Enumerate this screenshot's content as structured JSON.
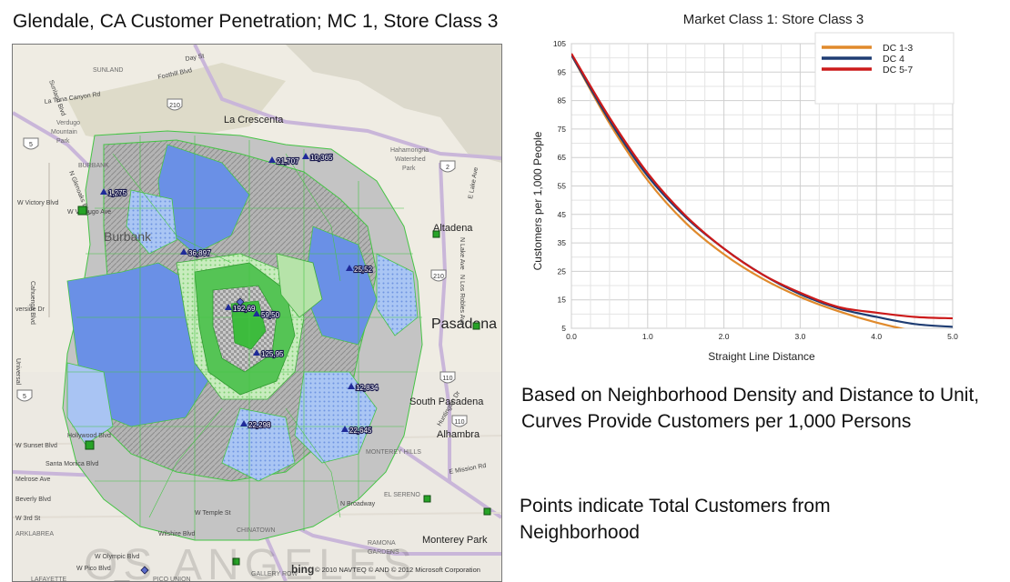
{
  "page": {
    "title": "Glendale, CA  Customer Penetration; MC 1, Store Class 3",
    "caption_curves": "Based on Neighborhood Density and Distance to Unit, Curves Provide Customers per 1,000 Persons",
    "caption_points": "Points indicate Total Customers from Neighborhood"
  },
  "map": {
    "place_labels": [
      {
        "text": "SUNLAND",
        "cls": "small"
      },
      {
        "text": "La Tuna Canyon Rd",
        "cls": "road"
      },
      {
        "text": "Verdugo",
        "cls": "small"
      },
      {
        "text": "Mountain",
        "cls": "small"
      },
      {
        "text": "Park",
        "cls": "small"
      },
      {
        "text": "La Crescenta",
        "cls": "town"
      },
      {
        "text": "Hahamongna",
        "cls": "small"
      },
      {
        "text": "Watershed",
        "cls": "small"
      },
      {
        "text": "Park",
        "cls": "small"
      },
      {
        "text": "Burbank",
        "cls": "townbig"
      },
      {
        "text": "Altadena",
        "cls": "town"
      },
      {
        "text": "Pasadena",
        "cls": "city"
      },
      {
        "text": "South Pasadena",
        "cls": "town"
      },
      {
        "text": "Alhambra",
        "cls": "town"
      },
      {
        "text": "MONTEREY HILLS",
        "cls": "small"
      },
      {
        "text": "EL SERENO",
        "cls": "small"
      },
      {
        "text": "Monterey Park",
        "cls": "town"
      },
      {
        "text": "CHINATOWN",
        "cls": "small"
      },
      {
        "text": "RAMONA",
        "cls": "small"
      },
      {
        "text": "GARDENS",
        "cls": "small"
      },
      {
        "text": "GALLERY ROW",
        "cls": "small"
      },
      {
        "text": "PICO UNION",
        "cls": "small"
      },
      {
        "text": "ARKLABREA",
        "cls": "small"
      },
      {
        "text": "Hollywood Blvd",
        "cls": "road"
      },
      {
        "text": "W Sunset Blvd",
        "cls": "road"
      },
      {
        "text": "Santa Monica Blvd",
        "cls": "road"
      },
      {
        "text": "Melrose Ave",
        "cls": "road"
      },
      {
        "text": "Beverly Blvd",
        "cls": "road"
      },
      {
        "text": "W 3rd St",
        "cls": "road"
      },
      {
        "text": "Wilshire Blvd",
        "cls": "road"
      },
      {
        "text": "W Olympic Blvd",
        "cls": "road"
      },
      {
        "text": "W Pico Blvd",
        "cls": "road"
      },
      {
        "text": "LAFAYETTE",
        "cls": "small"
      },
      {
        "text": "Universal",
        "cls": "road"
      },
      {
        "text": "verside Dr",
        "cls": "road"
      },
      {
        "text": "W Victory Blvd",
        "cls": "road"
      },
      {
        "text": "N Glenoaks Blvd",
        "cls": "road"
      },
      {
        "text": "W Verdugo Ave",
        "cls": "road"
      },
      {
        "text": "Foothill Blvd",
        "cls": "road"
      },
      {
        "text": "Day St",
        "cls": "road"
      },
      {
        "text": "Huntington Dr",
        "cls": "road"
      },
      {
        "text": "N Broadway",
        "cls": "road"
      },
      {
        "text": "W Temple St",
        "cls": "road"
      },
      {
        "text": "E Lake Ave",
        "cls": "road"
      },
      {
        "text": "N Lake Ave",
        "cls": "road"
      },
      {
        "text": "N Los Robles Ave",
        "cls": "road"
      },
      {
        "text": "E Mission Rd",
        "cls": "road"
      },
      {
        "text": "Cahuenga Blvd",
        "cls": "road"
      },
      {
        "text": "Sunland Blvd",
        "cls": "road"
      },
      {
        "text": "BURBANK",
        "cls": "small"
      }
    ],
    "shields": [
      "5",
      "210",
      "2",
      "210",
      "110",
      "110",
      "5",
      "10"
    ],
    "points": [
      {
        "label": "1,275"
      },
      {
        "label": "21,707"
      },
      {
        "label": "10,365"
      },
      {
        "label": "36,897"
      },
      {
        "label": "25,52"
      },
      {
        "label": "192,69"
      },
      {
        "label": "59,50"
      },
      {
        "label": "125,95"
      },
      {
        "label": "12,834"
      },
      {
        "label": "22,298"
      },
      {
        "label": "22,645"
      }
    ],
    "attribution": "© 2010 NAVTEQ  © AND  © 2012 Microsoft Corporation",
    "provider": "bing",
    "watermark": "OS ANGELES",
    "colors": {
      "green": "#3ec33e",
      "blue": "#5585e6",
      "lightblue": "#a9c4f3",
      "gray": "#a6a6a6",
      "lightgreen": "#bfe8b5",
      "store": "#27a327"
    }
  },
  "chart_data": {
    "type": "line",
    "title": "Market Class 1: Store Class 3",
    "xlabel": "Straight Line Distance",
    "ylabel": "Customers per 1,000 People",
    "xlim": [
      0,
      5
    ],
    "ylim": [
      5,
      105
    ],
    "xticks": [
      "0.0",
      "1.0",
      "2.0",
      "3.0",
      "4.0",
      "5.0"
    ],
    "yticks": [
      "5",
      "15",
      "25",
      "35",
      "45",
      "55",
      "65",
      "75",
      "85",
      "95",
      "105"
    ],
    "grid": true,
    "legend_position": "top-right",
    "x": [
      0,
      0.5,
      1,
      1.5,
      2,
      2.5,
      3,
      3.5,
      4,
      4.5,
      5
    ],
    "series": [
      {
        "name": "DC 1-3",
        "color": "#e08a2c",
        "values": [
          101,
          77,
          57,
          42,
          31,
          22.5,
          16,
          11,
          7,
          4,
          2
        ]
      },
      {
        "name": "DC 4",
        "color": "#1f3d73",
        "values": [
          101,
          78,
          58.5,
          44,
          33,
          24,
          17,
          12,
          9,
          6.5,
          5.5
        ]
      },
      {
        "name": "DC 5-7",
        "color": "#cc1a1a",
        "values": [
          101.5,
          79,
          59.5,
          44.5,
          33,
          24,
          17.5,
          12.5,
          10.5,
          9,
          8.5
        ]
      }
    ]
  }
}
